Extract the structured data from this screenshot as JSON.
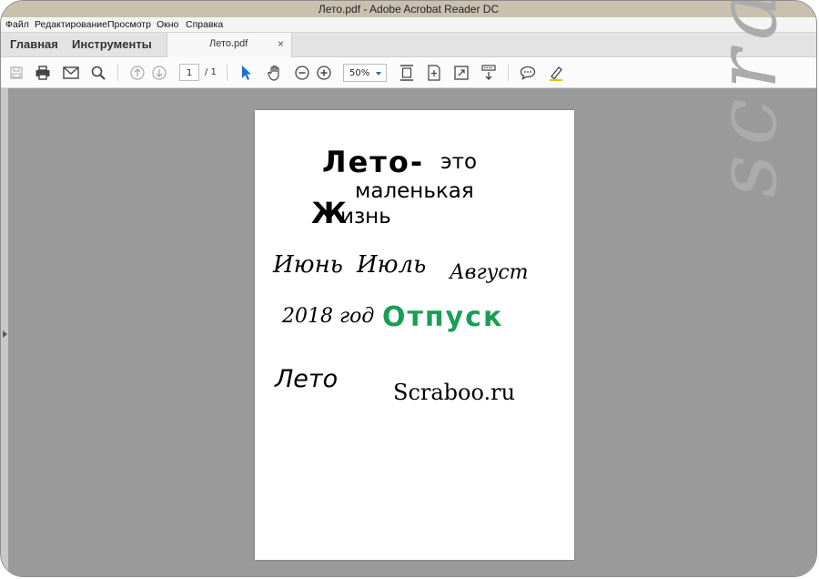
{
  "window": {
    "title": "Лето.pdf - Adobe Acrobat Reader DC"
  },
  "menu": [
    "Файл",
    "Редактирование",
    "Просмотр",
    "Окно",
    "Справка"
  ],
  "tabs": {
    "home": "Главная",
    "tools": "Инструменты",
    "document": "Лето.pdf",
    "close": "×"
  },
  "toolbar": {
    "page_current": "1",
    "page_total": "/ 1",
    "zoom": "50%",
    "accent_color": "#1f6fd0"
  },
  "page_content": {
    "line1_a": "Лето-",
    "line1_b": "это",
    "line2": "маленькая",
    "line3_a": "Ж",
    "line3_b": "изнь",
    "month1": "Июнь",
    "month2": "Июль",
    "month3": "Август",
    "year": "2018 год",
    "vacation": "Отпуск",
    "vacation_color": "#1a9e57",
    "summer": "Лето",
    "site": "Scraboo.ru"
  },
  "watermark": "scraboo"
}
